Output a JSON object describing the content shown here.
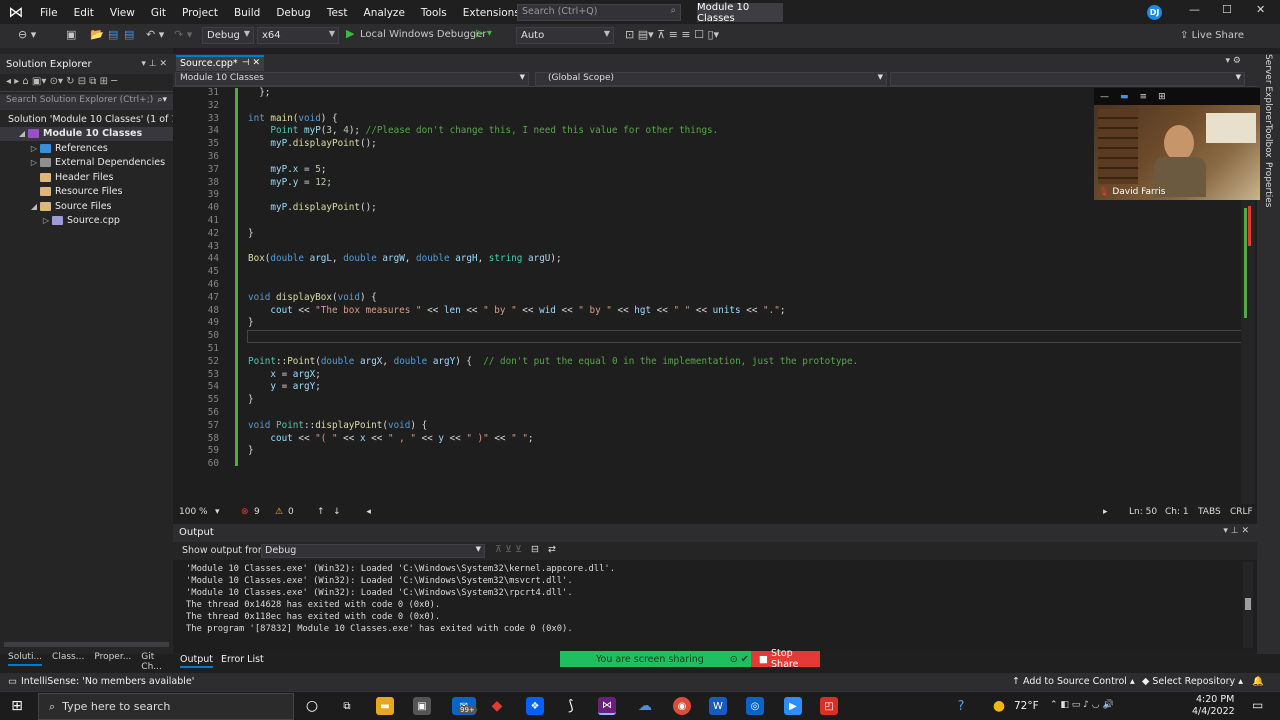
{
  "titlebar": {
    "menu": [
      "File",
      "Edit",
      "View",
      "Git",
      "Project",
      "Build",
      "Debug",
      "Test",
      "Analyze",
      "Tools",
      "Extensions",
      "Window",
      "Help"
    ],
    "search_placeholder": "Search (Ctrl+Q)",
    "solution_name": "Module 10 Classes",
    "user_initials": "DJ"
  },
  "toolbar": {
    "config": "Debug",
    "platform": "x64",
    "debugger": "Local Windows Debugger",
    "auto": "Auto",
    "live_share": "Live Share"
  },
  "solution_explorer": {
    "title": "Solution Explorer",
    "search_placeholder": "Search Solution Explorer (Ctrl+;)",
    "items": [
      {
        "label": "Solution 'Module 10 Classes' (1 of 1",
        "indent": 0
      },
      {
        "label": "Module 10 Classes",
        "indent": 1
      },
      {
        "label": "References",
        "indent": 2
      },
      {
        "label": "External Dependencies",
        "indent": 2
      },
      {
        "label": "Header Files",
        "indent": 2
      },
      {
        "label": "Resource Files",
        "indent": 2
      },
      {
        "label": "Source Files",
        "indent": 2
      },
      {
        "label": "Source.cpp",
        "indent": 3
      }
    ],
    "bottom_tabs": [
      "Soluti...",
      "Class...",
      "Proper...",
      "Git Ch..."
    ]
  },
  "editor": {
    "tab": "Source.cpp*",
    "nav_project": "Module 10 Classes",
    "nav_scope": "(Global Scope)",
    "zoom": "100 %",
    "errors": "9",
    "warnings": "0",
    "ln": "Ln: 50",
    "ch": "Ch: 1",
    "tabs": "TABS",
    "crlf": "CRLF"
  },
  "code_lines": [
    {
      "n": "31",
      "html": "  };"
    },
    {
      "n": "32",
      "html": ""
    },
    {
      "n": "33",
      "html": "<span class='kw'>int</span> <span class='fn'>main</span>(<span class='kw'>void</span>) {"
    },
    {
      "n": "34",
      "html": "    <span class='ty'>Point</span> <span class='var'>myP</span>(<span class='num'>3</span>, <span class='num'>4</span>); <span class='cm'>//Please don't change this, I need this value for other things.</span>"
    },
    {
      "n": "35",
      "html": "    <span class='var'>myP</span>.<span class='fn'>displayPoint</span>();"
    },
    {
      "n": "36",
      "html": ""
    },
    {
      "n": "37",
      "html": "    <span class='var'>myP</span>.<span class='var'>x</span> = <span class='num'>5</span>;"
    },
    {
      "n": "38",
      "html": "    <span class='var'>myP</span>.<span class='var'>y</span> = <span class='num'>12</span>;"
    },
    {
      "n": "39",
      "html": ""
    },
    {
      "n": "40",
      "html": "    <span class='var'>myP</span>.<span class='fn'>displayPoint</span>();"
    },
    {
      "n": "41",
      "html": ""
    },
    {
      "n": "42",
      "html": "}"
    },
    {
      "n": "43",
      "html": ""
    },
    {
      "n": "44",
      "html": "<span class='fn'>Box</span>(<span class='kw'>double</span> <span class='var'>argL</span>, <span class='kw'>double</span> <span class='var'>argW</span>, <span class='kw'>double</span> <span class='var'>argH</span>, <span class='ty'>string</span> <span class='var'>argU</span>);"
    },
    {
      "n": "45",
      "html": ""
    },
    {
      "n": "46",
      "html": ""
    },
    {
      "n": "47",
      "html": "<span class='kw'>void</span> <span class='fn'>displayBox</span>(<span class='kw'>void</span>) {"
    },
    {
      "n": "48",
      "html": "    <span class='var'>cout</span> &lt;&lt; <span class='str'>\"The box measures \"</span> &lt;&lt; <span class='var'>len</span> &lt;&lt; <span class='str'>\" by \"</span> &lt;&lt; <span class='var'>wid</span> &lt;&lt; <span class='str'>\" by \"</span> &lt;&lt; <span class='var'>hgt</span> &lt;&lt; <span class='str'>\" \"</span> &lt;&lt; <span class='var'>units</span> &lt;&lt; <span class='str'>\".\"</span>;"
    },
    {
      "n": "49",
      "html": "}"
    },
    {
      "n": "50",
      "html": ""
    },
    {
      "n": "51",
      "html": ""
    },
    {
      "n": "52",
      "html": "<span class='ty'>Point</span>::<span class='fn'>Point</span>(<span class='kw'>double</span> <span class='var'>argX</span>, <span class='kw'>double</span> <span class='var'>argY</span>) {  <span class='cm'>// don't put the equal 0 in the implementation, just the prototype.</span>"
    },
    {
      "n": "53",
      "html": "    <span class='var'>x</span> = <span class='var'>argX</span>;"
    },
    {
      "n": "54",
      "html": "    <span class='var'>y</span> = <span class='var'>argY</span>;"
    },
    {
      "n": "55",
      "html": "}"
    },
    {
      "n": "56",
      "html": ""
    },
    {
      "n": "57",
      "html": "<span class='kw'>void</span> <span class='ty'>Point</span>::<span class='fn'>displayPoint</span>(<span class='kw'>void</span>) {"
    },
    {
      "n": "58",
      "html": "    <span class='var'>cout</span> &lt;&lt; <span class='str'>\"( \"</span> &lt;&lt; <span class='var'>x</span> &lt;&lt; <span class='str'>\" , \"</span> &lt;&lt; <span class='var'>y</span> &lt;&lt; <span class='str'>\" )\"</span> &lt;&lt; <span class='str'>\" \"</span>;"
    },
    {
      "n": "59",
      "html": "}"
    },
    {
      "n": "60",
      "html": ""
    }
  ],
  "output": {
    "title": "Output",
    "show_from_label": "Show output from:",
    "source": "Debug",
    "text": "'Module 10 Classes.exe' (Win32): Loaded 'C:\\Windows\\System32\\kernel.appcore.dll'.\n'Module 10 Classes.exe' (Win32): Loaded 'C:\\Windows\\System32\\msvcrt.dll'.\n'Module 10 Classes.exe' (Win32): Loaded 'C:\\Windows\\System32\\rpcrt4.dll'.\nThe thread 0x14628 has exited with code 0 (0x0).\nThe thread 0x118ec has exited with code 0 (0x0).\nThe program '[87832] Module 10 Classes.exe' has exited with code 0 (0x0).",
    "tabs": [
      "Output",
      "Error List"
    ]
  },
  "right_rail": [
    "Server Explorer",
    "Toolbox",
    "Properties"
  ],
  "video": {
    "name": "David Farris"
  },
  "sharing": {
    "message": "You are screen sharing",
    "stop": "Stop Share"
  },
  "statusbar": {
    "intellisense": "IntelliSense: 'No members available'",
    "add_source": "Add to Source Control",
    "select_repo": "Select Repository"
  },
  "taskbar": {
    "search_placeholder": "Type here to search",
    "badge": "99+",
    "weather": "72°F",
    "time": "4:20 PM",
    "date": "4/4/2022"
  }
}
